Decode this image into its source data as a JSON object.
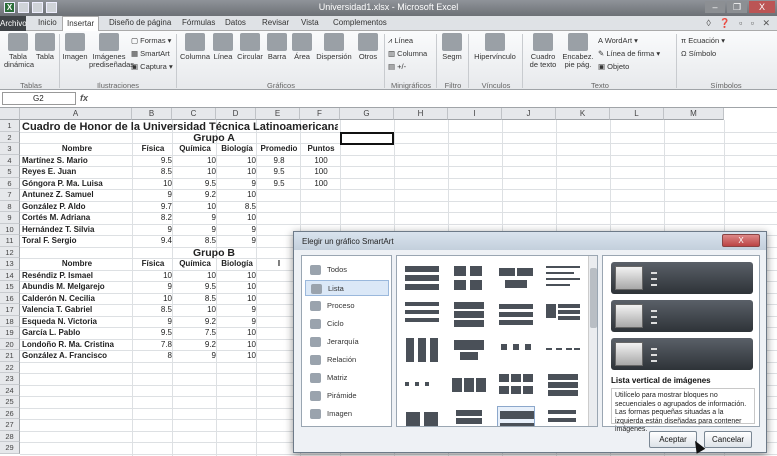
{
  "window": {
    "title": "Universidad1.xlsx - Microsoft Excel",
    "minimize": "–",
    "restore": "❐",
    "close": "X"
  },
  "tabs": [
    "Archivo",
    "Inicio",
    "Insertar",
    "Diseño de página",
    "Fórmulas",
    "Datos",
    "Revisar",
    "Vista",
    "Complementos"
  ],
  "active_tab": "Insertar",
  "ribbon": {
    "groups": [
      "Tablas",
      "Ilustraciones",
      "Gráficos",
      "Minigráficos",
      "Filtro",
      "Vínculos",
      "Texto",
      "Símbolos"
    ],
    "buttons": {
      "tabla_dinamica": "Tabla dinámica",
      "tabla": "Tabla",
      "imagen": "Imagen",
      "imagenes_pred": "Imágenes prediseñadas",
      "formas": "Formas",
      "smartart": "SmartArt",
      "captura": "Captura",
      "columna": "Columna",
      "linea": "Línea",
      "circular": "Circular",
      "barra": "Barra",
      "area": "Área",
      "dispersion": "Dispersión",
      "otros": "Otros",
      "spark_linea": "Línea",
      "spark_columna": "Columna",
      "spark_pm": "+/-",
      "segm": "Segm",
      "hipervinculo": "Hipervínculo",
      "cuadro_texto": "Cuadro de texto",
      "encabez": "Encabez. pie pág.",
      "wordart": "WordArt",
      "linea_firma": "Línea de firma",
      "objeto": "Objeto",
      "ecuacion": "Ecuación",
      "simbolo": "Símbolo"
    }
  },
  "namebox": "G2",
  "fx": "fx",
  "columns": [
    "A",
    "B",
    "C",
    "D",
    "E",
    "F",
    "G",
    "H",
    "I",
    "J",
    "K",
    "L",
    "M"
  ],
  "rows": [
    "1",
    "2",
    "3",
    "4",
    "5",
    "6",
    "7",
    "8",
    "9",
    "10",
    "11",
    "12",
    "13",
    "14",
    "15",
    "16",
    "17",
    "18",
    "19",
    "20",
    "21",
    "22",
    "23",
    "24",
    "25",
    "26",
    "27",
    "28",
    "29"
  ],
  "sheet": {
    "title": "Cuadro de Honor de la Universidad Técnica Latinoamericana",
    "grupoA": "Grupo A",
    "grupoB": "Grupo B",
    "headersA": [
      "Nombre",
      "Física",
      "Química",
      "Biología",
      "Promedio",
      "Puntos"
    ],
    "headersB": [
      "Nombre",
      "Física",
      "Química",
      "Biología",
      "I"
    ],
    "rowsA": [
      [
        "Martínez S. Mario",
        "9.5",
        "10",
        "10",
        "9.8",
        "100"
      ],
      [
        "Reyes E. Juan",
        "8.5",
        "10",
        "10",
        "9.5",
        "100"
      ],
      [
        "Góngora P. Ma. Luisa",
        "10",
        "9.5",
        "9",
        "9.5",
        "100"
      ],
      [
        "Antunez Z. Samuel",
        "9",
        "9.2",
        "10",
        "",
        ""
      ],
      [
        "González P. Aldo",
        "9.7",
        "10",
        "8.5",
        "",
        ""
      ],
      [
        "Cortés M. Adriana",
        "8.2",
        "9",
        "10",
        "",
        ""
      ],
      [
        "Hernández T. Silvia",
        "9",
        "9",
        "9",
        "",
        ""
      ],
      [
        "Toral F. Sergio",
        "9.4",
        "8.5",
        "9",
        "",
        ""
      ]
    ],
    "rowsB": [
      [
        "Reséndiz P. Ismael",
        "10",
        "10",
        "10"
      ],
      [
        "Abundis M. Melgarejo",
        "9",
        "9.5",
        "10"
      ],
      [
        "Calderón N. Cecilia",
        "10",
        "8.5",
        "10"
      ],
      [
        "Valencia T. Gabriel",
        "8.5",
        "10",
        "9"
      ],
      [
        "Esqueda N. Victoria",
        "9",
        "9.2",
        "9"
      ],
      [
        "García L. Pablo",
        "9.5",
        "7.5",
        "10"
      ],
      [
        "Londoño R. Ma. Cristina",
        "7.8",
        "9.2",
        "10"
      ],
      [
        "González A. Francisco",
        "8",
        "9",
        "10"
      ]
    ]
  },
  "dialog": {
    "title": "Elegir un gráfico SmartArt",
    "close": "X",
    "categories": [
      "Todos",
      "Lista",
      "Proceso",
      "Ciclo",
      "Jerarquía",
      "Relación",
      "Matriz",
      "Pirámide",
      "Imagen"
    ],
    "selected_category": "Lista",
    "preview_name": "Lista vertical de imágenes",
    "preview_desc": "Utilícelo para mostrar bloques no secuenciales o agrupados de información. Las formas pequeñas situadas a la izquierda están diseñadas para contener imágenes.",
    "accept": "Aceptar",
    "cancel": "Cancelar"
  }
}
